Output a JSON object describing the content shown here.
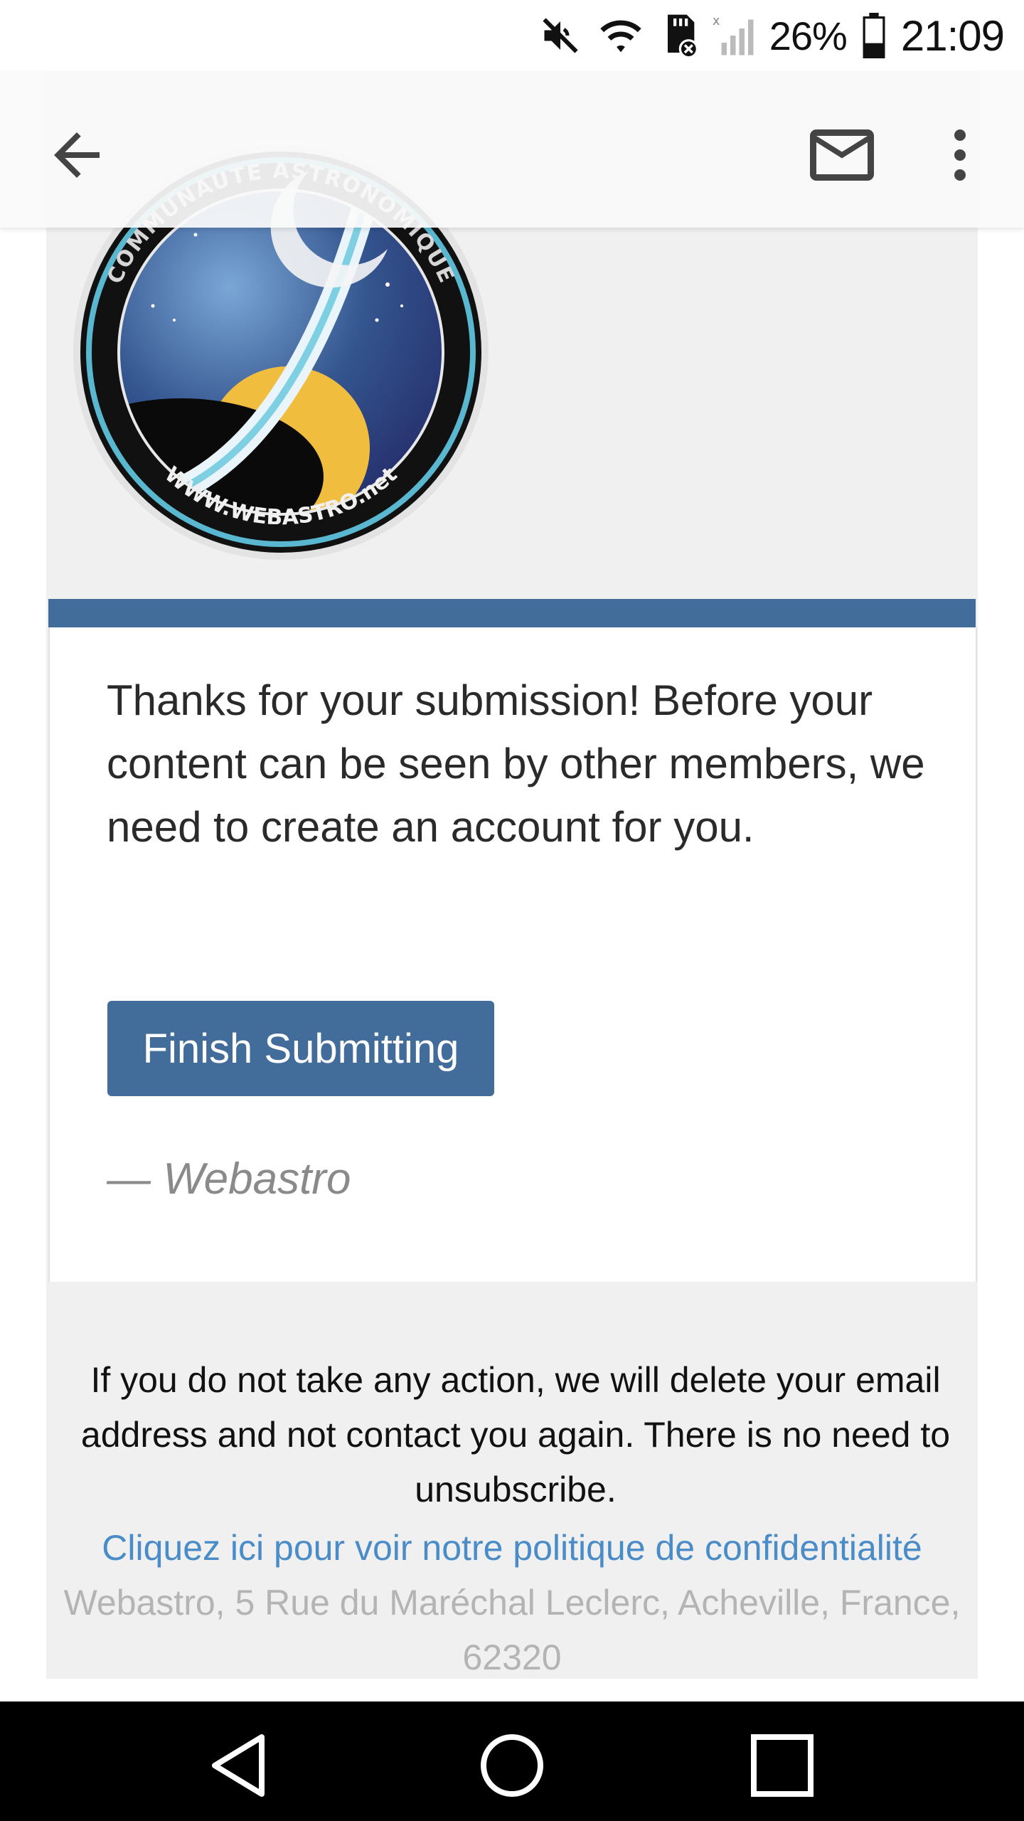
{
  "status_bar": {
    "battery": "26%",
    "time": "21:09",
    "icons": [
      "mute-icon",
      "wifi-icon",
      "sd-card-icon",
      "signal-icon",
      "battery-icon"
    ]
  },
  "app_bar": {
    "icons": [
      "back-arrow-icon",
      "mail-icon",
      "more-vert-icon"
    ]
  },
  "email": {
    "logo": {
      "ring_text_top": "COMMUNAUTE ASTRONOMIQUE",
      "ring_text_bottom": "WWW.WEBASTRO.net"
    },
    "message": "Thanks for your submission! Before your content can be seen by other members, we need to create an account for you.",
    "button_label": "Finish Submitting",
    "signature": "— Webastro",
    "footer": {
      "notice": "If you do not take any action, we will delete your email address and not contact you again. There is no need to unsubscribe.",
      "privacy_link": "Cliquez ici pour voir notre politique de confidentialité",
      "address": "Webastro, 5 Rue du Maréchal Leclerc, Acheville, France, 62320"
    },
    "colors": {
      "accent": "#426d9a",
      "link": "#4a8cc8",
      "background": "#f0f0f0"
    }
  },
  "nav_bar": {
    "icons": [
      "back-triangle-icon",
      "home-circle-icon",
      "recents-square-icon"
    ]
  }
}
